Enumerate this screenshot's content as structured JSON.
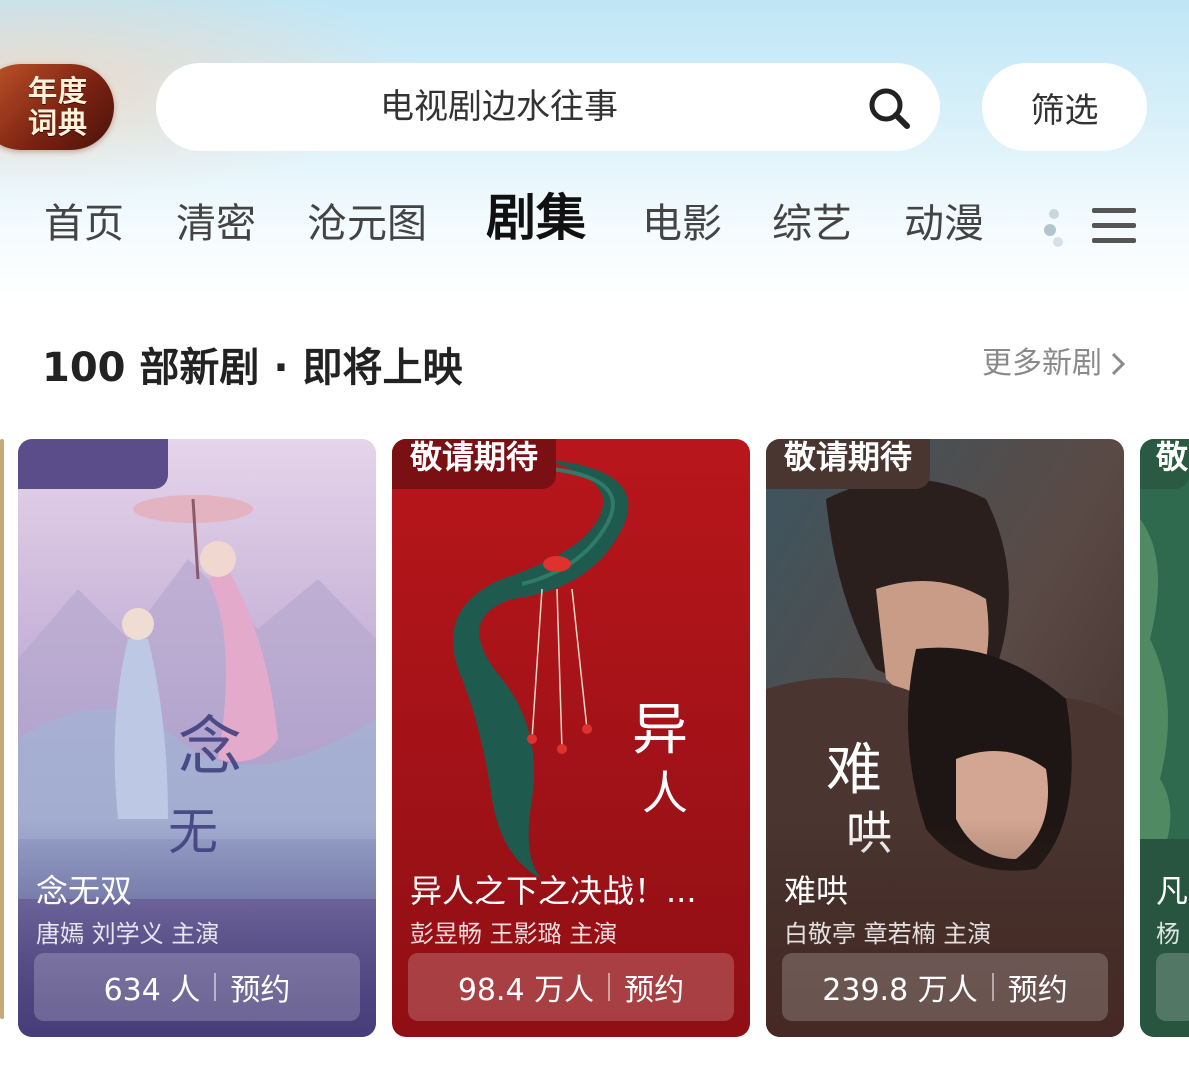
{
  "badge": {
    "line1": "年度",
    "line2": "词典"
  },
  "search": {
    "query": "电视剧边水往事"
  },
  "filter_label": "筛选",
  "nav": {
    "tabs": [
      "首页",
      "清密",
      "沧元图",
      "剧集",
      "电影",
      "综艺",
      "动漫"
    ],
    "active": "剧集"
  },
  "section": {
    "title": "100 部新剧 · 即将上映",
    "more": "更多新剧"
  },
  "cards": [
    {
      "tag": "",
      "title": "念无双",
      "cast": "唐嫣 刘学义 主演",
      "count": "634 人",
      "action": "预约",
      "poster_text": "念无双",
      "color": "#6a5a94"
    },
    {
      "tag": "敬请期待",
      "title": "异人之下之决战！...",
      "cast": "彭昱畅 王影璐 主演",
      "count": "98.4 万人",
      "action": "预约",
      "poster_text": "异人之下",
      "color": "#a51a1f"
    },
    {
      "tag": "敬请期待",
      "title": "难哄",
      "cast": "白敬亭 章若楠 主演",
      "count": "239.8 万人",
      "action": "预约",
      "poster_text": "难哄",
      "color": "#5a3b33"
    },
    {
      "tag": "敬",
      "title": "凡",
      "cast": "杨",
      "color": "#2f6a4e"
    }
  ]
}
